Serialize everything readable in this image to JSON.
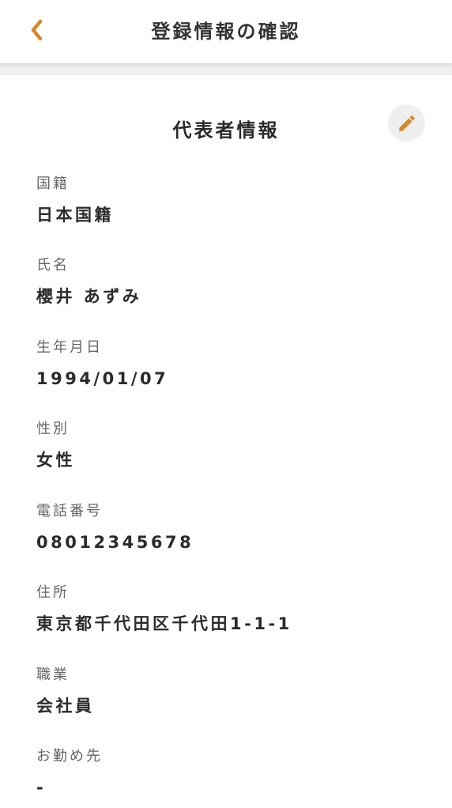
{
  "header": {
    "title": "登録情報の確認",
    "back_icon": "chevron-left-icon"
  },
  "colors": {
    "accent": "#D4882A",
    "background": "#FFFFFF",
    "divider": "#F0F0F0",
    "text": "#2B2B2B",
    "label": "#666666"
  },
  "section": {
    "title": "代表者情報",
    "edit_icon": "pencil-icon"
  },
  "fields": [
    {
      "label": "国籍",
      "value": "日本国籍"
    },
    {
      "label": "氏名",
      "value": "櫻井 あずみ"
    },
    {
      "label": "生年月日",
      "value": "1994/01/07"
    },
    {
      "label": "性別",
      "value": "女性"
    },
    {
      "label": "電話番号",
      "value": "08012345678"
    },
    {
      "label": "住所",
      "value": "東京都千代田区千代田1-1-1"
    },
    {
      "label": "職業",
      "value": "会社員"
    },
    {
      "label": "お勤め先",
      "value": "-"
    }
  ]
}
